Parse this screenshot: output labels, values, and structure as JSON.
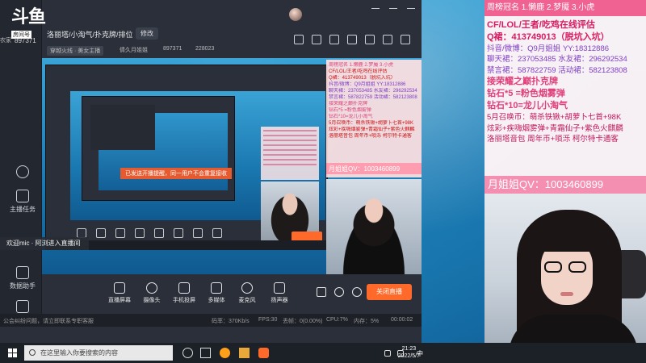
{
  "app": {
    "logo_text": "斗鱼",
    "logo_sub": "房间号",
    "room_id": "897371",
    "room_tag": "洛丽塔/小淘气/扑克牌/排位",
    "edit_label": "修改",
    "category": "穿越火线 · 美女主播",
    "streamer": "倩久月姐姐",
    "fans": "897371",
    "hot": "228023",
    "sidebar_left_label": "农家",
    "sidebar": [
      {
        "label": "...",
        "icon": "more-icon"
      },
      {
        "label": "主播任务",
        "icon": "task-icon"
      },
      {
        "label": "数据助手",
        "icon": "data-icon"
      },
      {
        "label": "",
        "icon": "home-icon"
      }
    ]
  },
  "canvas": {
    "inner_banner": "已发送开播提醒，同一用户不会重复接收",
    "overlay": {
      "lines": [
        {
          "text": "周榜冠名 1.懒鹿 2.梦魇 3.小虎",
          "cls": "pink"
        },
        {
          "text": "CF/LOL/王者/吃鸡在线评估",
          "cls": "red"
        },
        {
          "text": "Q裙：413749013（脱坑入坑）",
          "cls": "red"
        },
        {
          "text": "抖音/微博：Q9月姐姐  YY:18312886",
          "cls": "purple"
        },
        {
          "text": "聊天裙：237053485 水友裙：296292534",
          "cls": "purple"
        },
        {
          "text": "禁言裙：587822759 活动裙：582123808",
          "cls": "purple"
        },
        {
          "text": "接荣耀之巅扑克牌",
          "cls": "pink"
        },
        {
          "text": "钻石*5 =粉色烟雾弹",
          "cls": "pink"
        },
        {
          "text": "钻石*10=龙儿小淘气",
          "cls": "pink"
        },
        {
          "text": "5月召唤币：萌杀铁锹+胡萝卜七首+98K",
          "cls": "red"
        },
        {
          "text": "炫彩+疾嗨烟雾弹+青霜仙子+紫色火麒麟",
          "cls": "red"
        },
        {
          "text": "洛丽塔音包 周年币+唢泺 柯尔特卡通客",
          "cls": "red"
        }
      ],
      "qv": "月姐姐QV：1003460899"
    }
  },
  "controls": [
    {
      "label": "直播屏幕",
      "icon": "screen-icon"
    },
    {
      "label": "摄像头",
      "icon": "camera-icon"
    },
    {
      "label": "手机投屏",
      "icon": "phone-cast-icon"
    },
    {
      "label": "多媒体",
      "icon": "media-icon"
    },
    {
      "label": "麦克风",
      "icon": "mic-icon"
    },
    {
      "label": "扬声器",
      "icon": "speaker-icon"
    }
  ],
  "golive_label": "关闭直播",
  "status": {
    "warning": "公会纠纷问题，请立即联系专职客服",
    "bitrate": "码率：370Kb/s",
    "fps": "FPS:30",
    "drop": "丢帧：0(0.00%)",
    "cpu": "CPU:7%",
    "mem": "内存：5%",
    "time": "00:00:02"
  },
  "taskbar": {
    "search_placeholder": "在这里输入你要搜索的内容",
    "lang": "中",
    "time": "21:23",
    "date": "2022/5/7"
  },
  "float_tip": "欢迎mic · 阿浏进入直播间",
  "right_panel": {
    "rank": "周榜冠名 1.懒鹿 2.梦魇 3.小虎",
    "lines": [
      {
        "text": "CF/LOL/王者/吃鸡在线评估",
        "cls": "c-red",
        "big": true
      },
      {
        "text": "Q裙：413749013（脱坑入坑）",
        "cls": "c-red",
        "big": true
      },
      {
        "text": "抖音/微博：Q9月姐姐    YY:18312886",
        "cls": "c-purple",
        "big": false
      },
      {
        "text": "聊天裙：237053485 水友裙：296292534",
        "cls": "c-purple",
        "big": false
      },
      {
        "text": "禁言裙：587822759 活动裙：582123808",
        "cls": "c-purple",
        "big": false
      },
      {
        "text": "接荣耀之巅扑克牌",
        "cls": "c-pink",
        "big": true
      },
      {
        "text": "钻石*5 =粉色烟雾弹",
        "cls": "c-pink",
        "big": true
      },
      {
        "text": "钻石*10=龙儿小淘气",
        "cls": "c-pink",
        "big": true
      },
      {
        "text": "5月召唤币：萌杀铁锹+胡萝卜七首+98K",
        "cls": "c-mag",
        "big": false
      },
      {
        "text": "炫彩+疾嗨烟雾弹+青霜仙子+紫色火麒麟",
        "cls": "c-mag",
        "big": false
      },
      {
        "text": "洛丽塔音包 周年币+唢泺 柯尔特卡通客",
        "cls": "c-mag",
        "big": false
      }
    ],
    "qv": "月姐姐QV：1003460899"
  }
}
